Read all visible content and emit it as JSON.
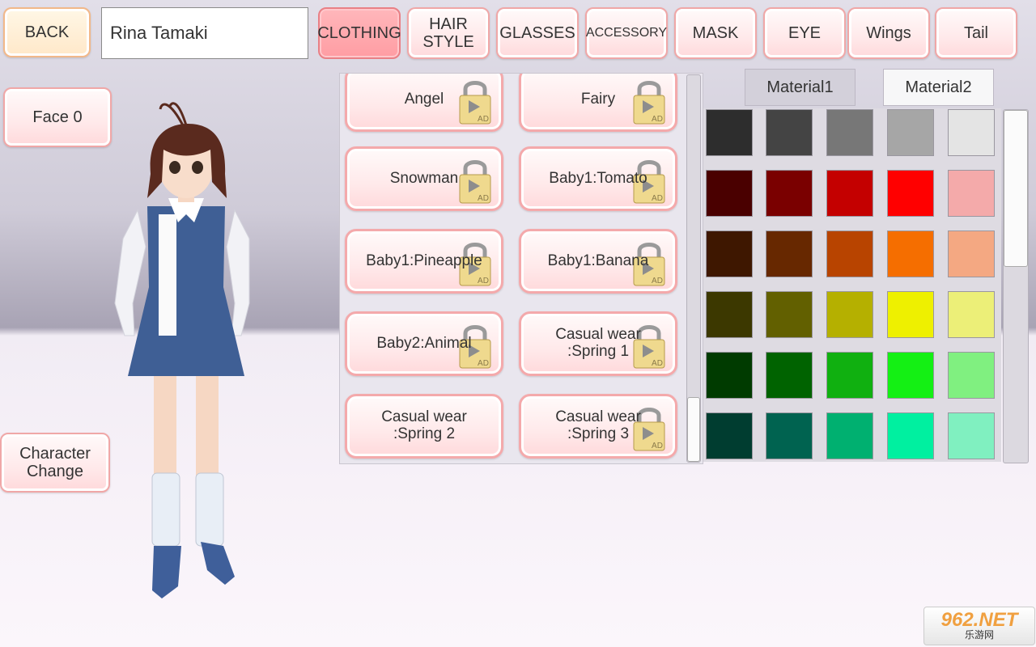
{
  "top": {
    "back_label": "BACK",
    "character_name": "Rina Tamaki",
    "tabs": [
      {
        "label": "CLOTHING",
        "active": true
      },
      {
        "label": "HAIR\nSTYLE",
        "active": false
      },
      {
        "label": "GLASSES",
        "active": false
      },
      {
        "label": "ACCESSORY",
        "active": false
      },
      {
        "label": "MASK",
        "active": false
      },
      {
        "label": "EYE",
        "active": false
      },
      {
        "label": "Wings",
        "active": false
      },
      {
        "label": "Tail",
        "active": false
      }
    ]
  },
  "left": {
    "face_label": "Face",
    "face_value": "0",
    "character_change_label": "Character\nChange"
  },
  "outfits": [
    {
      "label": "Angel",
      "locked": true
    },
    {
      "label": "Fairy",
      "locked": true
    },
    {
      "label": "Snowman",
      "locked": true
    },
    {
      "label": "Baby1:Tomato",
      "locked": true
    },
    {
      "label": "Baby1:Pineapple",
      "locked": true
    },
    {
      "label": "Baby1:Banana",
      "locked": true
    },
    {
      "label": "Baby2:Animal",
      "locked": true
    },
    {
      "label": "Casual wear\n:Spring 1",
      "locked": true
    },
    {
      "label": "Casual wear\n:Spring 2",
      "locked": false
    },
    {
      "label": "Casual wear\n:Spring 3",
      "locked": true
    }
  ],
  "lock_badge": "AD",
  "materials": {
    "material1_label": "Material1",
    "material2_label": "Material2",
    "selected": "Material1"
  },
  "palette": [
    [
      "#2d2d2d",
      "#444444",
      "#777777",
      "#a6a6a6",
      "#e4e4e4"
    ],
    [
      "#4a0000",
      "#7a0000",
      "#c40000",
      "#ff0000",
      "#f4aaaa"
    ],
    [
      "#3e1700",
      "#672800",
      "#b84400",
      "#f56e00",
      "#f4a882"
    ],
    [
      "#3c3800",
      "#626000",
      "#b5b000",
      "#eef000",
      "#ecef78"
    ],
    [
      "#003b00",
      "#006300",
      "#10b010",
      "#14f014",
      "#80f080"
    ],
    [
      "#003d30",
      "#006350",
      "#00b070",
      "#00f0a0",
      "#80f0c0"
    ]
  ],
  "watermark": {
    "main": "962.NET",
    "sub": "乐游网"
  }
}
